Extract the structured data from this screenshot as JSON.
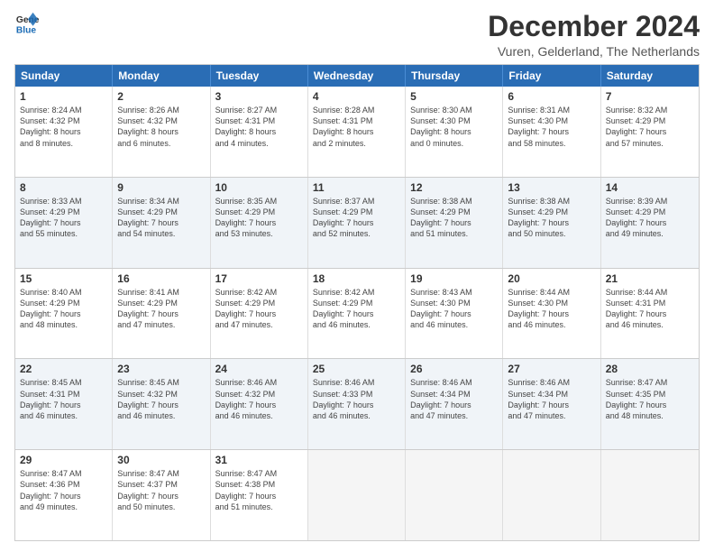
{
  "header": {
    "logo_line1": "General",
    "logo_line2": "Blue",
    "title": "December 2024",
    "subtitle": "Vuren, Gelderland, The Netherlands"
  },
  "weekdays": [
    "Sunday",
    "Monday",
    "Tuesday",
    "Wednesday",
    "Thursday",
    "Friday",
    "Saturday"
  ],
  "weeks": [
    [
      {
        "day": "1",
        "lines": [
          "Sunrise: 8:24 AM",
          "Sunset: 4:32 PM",
          "Daylight: 8 hours",
          "and 8 minutes."
        ]
      },
      {
        "day": "2",
        "lines": [
          "Sunrise: 8:26 AM",
          "Sunset: 4:32 PM",
          "Daylight: 8 hours",
          "and 6 minutes."
        ]
      },
      {
        "day": "3",
        "lines": [
          "Sunrise: 8:27 AM",
          "Sunset: 4:31 PM",
          "Daylight: 8 hours",
          "and 4 minutes."
        ]
      },
      {
        "day": "4",
        "lines": [
          "Sunrise: 8:28 AM",
          "Sunset: 4:31 PM",
          "Daylight: 8 hours",
          "and 2 minutes."
        ]
      },
      {
        "day": "5",
        "lines": [
          "Sunrise: 8:30 AM",
          "Sunset: 4:30 PM",
          "Daylight: 8 hours",
          "and 0 minutes."
        ]
      },
      {
        "day": "6",
        "lines": [
          "Sunrise: 8:31 AM",
          "Sunset: 4:30 PM",
          "Daylight: 7 hours",
          "and 58 minutes."
        ]
      },
      {
        "day": "7",
        "lines": [
          "Sunrise: 8:32 AM",
          "Sunset: 4:29 PM",
          "Daylight: 7 hours",
          "and 57 minutes."
        ]
      }
    ],
    [
      {
        "day": "8",
        "lines": [
          "Sunrise: 8:33 AM",
          "Sunset: 4:29 PM",
          "Daylight: 7 hours",
          "and 55 minutes."
        ]
      },
      {
        "day": "9",
        "lines": [
          "Sunrise: 8:34 AM",
          "Sunset: 4:29 PM",
          "Daylight: 7 hours",
          "and 54 minutes."
        ]
      },
      {
        "day": "10",
        "lines": [
          "Sunrise: 8:35 AM",
          "Sunset: 4:29 PM",
          "Daylight: 7 hours",
          "and 53 minutes."
        ]
      },
      {
        "day": "11",
        "lines": [
          "Sunrise: 8:37 AM",
          "Sunset: 4:29 PM",
          "Daylight: 7 hours",
          "and 52 minutes."
        ]
      },
      {
        "day": "12",
        "lines": [
          "Sunrise: 8:38 AM",
          "Sunset: 4:29 PM",
          "Daylight: 7 hours",
          "and 51 minutes."
        ]
      },
      {
        "day": "13",
        "lines": [
          "Sunrise: 8:38 AM",
          "Sunset: 4:29 PM",
          "Daylight: 7 hours",
          "and 50 minutes."
        ]
      },
      {
        "day": "14",
        "lines": [
          "Sunrise: 8:39 AM",
          "Sunset: 4:29 PM",
          "Daylight: 7 hours",
          "and 49 minutes."
        ]
      }
    ],
    [
      {
        "day": "15",
        "lines": [
          "Sunrise: 8:40 AM",
          "Sunset: 4:29 PM",
          "Daylight: 7 hours",
          "and 48 minutes."
        ]
      },
      {
        "day": "16",
        "lines": [
          "Sunrise: 8:41 AM",
          "Sunset: 4:29 PM",
          "Daylight: 7 hours",
          "and 47 minutes."
        ]
      },
      {
        "day": "17",
        "lines": [
          "Sunrise: 8:42 AM",
          "Sunset: 4:29 PM",
          "Daylight: 7 hours",
          "and 47 minutes."
        ]
      },
      {
        "day": "18",
        "lines": [
          "Sunrise: 8:42 AM",
          "Sunset: 4:29 PM",
          "Daylight: 7 hours",
          "and 46 minutes."
        ]
      },
      {
        "day": "19",
        "lines": [
          "Sunrise: 8:43 AM",
          "Sunset: 4:30 PM",
          "Daylight: 7 hours",
          "and 46 minutes."
        ]
      },
      {
        "day": "20",
        "lines": [
          "Sunrise: 8:44 AM",
          "Sunset: 4:30 PM",
          "Daylight: 7 hours",
          "and 46 minutes."
        ]
      },
      {
        "day": "21",
        "lines": [
          "Sunrise: 8:44 AM",
          "Sunset: 4:31 PM",
          "Daylight: 7 hours",
          "and 46 minutes."
        ]
      }
    ],
    [
      {
        "day": "22",
        "lines": [
          "Sunrise: 8:45 AM",
          "Sunset: 4:31 PM",
          "Daylight: 7 hours",
          "and 46 minutes."
        ]
      },
      {
        "day": "23",
        "lines": [
          "Sunrise: 8:45 AM",
          "Sunset: 4:32 PM",
          "Daylight: 7 hours",
          "and 46 minutes."
        ]
      },
      {
        "day": "24",
        "lines": [
          "Sunrise: 8:46 AM",
          "Sunset: 4:32 PM",
          "Daylight: 7 hours",
          "and 46 minutes."
        ]
      },
      {
        "day": "25",
        "lines": [
          "Sunrise: 8:46 AM",
          "Sunset: 4:33 PM",
          "Daylight: 7 hours",
          "and 46 minutes."
        ]
      },
      {
        "day": "26",
        "lines": [
          "Sunrise: 8:46 AM",
          "Sunset: 4:34 PM",
          "Daylight: 7 hours",
          "and 47 minutes."
        ]
      },
      {
        "day": "27",
        "lines": [
          "Sunrise: 8:46 AM",
          "Sunset: 4:34 PM",
          "Daylight: 7 hours",
          "and 47 minutes."
        ]
      },
      {
        "day": "28",
        "lines": [
          "Sunrise: 8:47 AM",
          "Sunset: 4:35 PM",
          "Daylight: 7 hours",
          "and 48 minutes."
        ]
      }
    ],
    [
      {
        "day": "29",
        "lines": [
          "Sunrise: 8:47 AM",
          "Sunset: 4:36 PM",
          "Daylight: 7 hours",
          "and 49 minutes."
        ]
      },
      {
        "day": "30",
        "lines": [
          "Sunrise: 8:47 AM",
          "Sunset: 4:37 PM",
          "Daylight: 7 hours",
          "and 50 minutes."
        ]
      },
      {
        "day": "31",
        "lines": [
          "Sunrise: 8:47 AM",
          "Sunset: 4:38 PM",
          "Daylight: 7 hours",
          "and 51 minutes."
        ]
      },
      {
        "day": "",
        "lines": []
      },
      {
        "day": "",
        "lines": []
      },
      {
        "day": "",
        "lines": []
      },
      {
        "day": "",
        "lines": []
      }
    ]
  ]
}
